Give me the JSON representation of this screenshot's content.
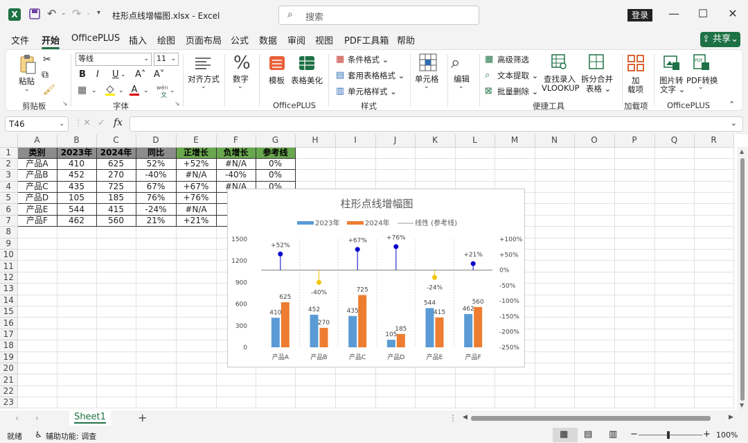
{
  "window": {
    "title": "柱形点线增幅图.xlsx - Excel",
    "search_placeholder": "搜索",
    "login_label": "登录"
  },
  "tabs": [
    "文件",
    "开始",
    "OfficePLUS",
    "插入",
    "绘图",
    "页面布局",
    "公式",
    "数据",
    "审阅",
    "视图",
    "PDF工具箱",
    "帮助"
  ],
  "share_label": "共享",
  "ribbon": {
    "paste": "粘贴",
    "font_name": "等线",
    "font_size": "11",
    "bold": "B",
    "italic": "I",
    "underline": "U",
    "grow_font": "A˄",
    "shrink_font": "A˅",
    "wen": "wén",
    "align": "对齐方式",
    "number": "数字",
    "template": "模板",
    "beautify": "表格美化",
    "cond_format": "条件格式",
    "table_format": "套用表格格式",
    "cell_style": "单元格样式",
    "cell": "单元格",
    "edit": "编辑",
    "adv_filter": "高级筛选",
    "text_extract": "文本提取",
    "batch_delete": "批量删除",
    "lookup_line1": "查找录入",
    "lookup_line2": "VLOOKUP",
    "split_line1": "拆分合并",
    "split_line2": "表格",
    "addin_line1": "加",
    "addin_line2": "载项",
    "img2text_line1": "图片转",
    "img2text_line2": "文字",
    "pdf_convert": "PDF转换",
    "groups": {
      "clipboard": "剪贴板",
      "font": "字体",
      "officeplus1": "OfficePLUS",
      "style": "样式",
      "quick_tools": "便捷工具",
      "addins": "加载项",
      "officeplus2": "OfficePLUS"
    }
  },
  "name_box": "T46",
  "fx_label": "fx",
  "columns": [
    "A",
    "B",
    "C",
    "D",
    "E",
    "F",
    "G",
    "H",
    "I",
    "J",
    "K",
    "L",
    "M",
    "N",
    "O",
    "P",
    "Q",
    "R"
  ],
  "row_numbers": [
    "1",
    "2",
    "3",
    "4",
    "5",
    "6",
    "7",
    "8",
    "9",
    "10",
    "11",
    "12",
    "13",
    "14",
    "15",
    "16",
    "17",
    "18",
    "19",
    "20",
    "21",
    "22",
    "23"
  ],
  "table": {
    "headers": [
      "类别",
      "2023年",
      "2024年",
      "同比",
      "正增长",
      "负增长",
      "参考线"
    ],
    "rows": [
      [
        "产品A",
        "410",
        "625",
        "52%",
        "+52%",
        "#N/A",
        "0%"
      ],
      [
        "产品B",
        "452",
        "270",
        "-40%",
        "#N/A",
        "-40%",
        "0%"
      ],
      [
        "产品C",
        "435",
        "725",
        "67%",
        "+67%",
        "#N/A",
        "0%"
      ],
      [
        "产品D",
        "105",
        "185",
        "76%",
        "+76%",
        "",
        ""
      ],
      [
        "产品E",
        "544",
        "415",
        "-24%",
        "#N/A",
        "",
        ""
      ],
      [
        "产品F",
        "462",
        "560",
        "21%",
        "+21%",
        "",
        ""
      ]
    ]
  },
  "chart_data": {
    "type": "bar",
    "title": "柱形点线增幅图",
    "categories": [
      "产品A",
      "产品B",
      "产品C",
      "产品D",
      "产品E",
      "产品F"
    ],
    "series": [
      {
        "name": "2023年",
        "values": [
          410,
          452,
          435,
          105,
          544,
          462
        ],
        "color": "#5b9bd5"
      },
      {
        "name": "2024年",
        "values": [
          625,
          270,
          725,
          185,
          415,
          560
        ],
        "color": "#ed7d31"
      }
    ],
    "reference_line_name": "线性 (参考线)",
    "growth": [
      52,
      -40,
      67,
      76,
      -24,
      21
    ],
    "growth_labels": [
      "+52%",
      "-40%",
      "+67%",
      "+76%",
      "-24%",
      "+21%"
    ],
    "pos_color": "#0000cc",
    "neg_color": "#f2c500",
    "ylim": [
      0,
      1500
    ],
    "yticks": [
      "1500",
      "1200",
      "900",
      "600",
      "300",
      "0"
    ],
    "y2lim": [
      -250,
      100
    ],
    "y2ticks": [
      "+100%",
      "+50%",
      "0%",
      "-50%",
      "-100%",
      "-150%",
      "-200%",
      "-250%"
    ],
    "legend": "top"
  },
  "sheet_tab": "Sheet1",
  "status": {
    "ready": "就绪",
    "accessibility": "辅助功能: 调查",
    "zoom": "100%"
  }
}
